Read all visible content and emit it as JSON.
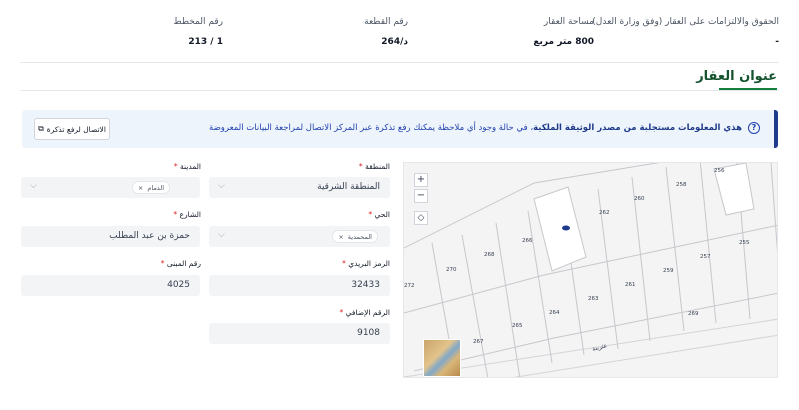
{
  "header": {
    "rights_label": "الحقوق والالتزامات على العقار (وفق وزارة العدل)",
    "rights_value": "-",
    "area_label": "مساحة العقار",
    "area_value": "800 متر مربع",
    "plot_label": "رقم القطعة",
    "plot_value": "264/د",
    "scheme_label": "رقم المخطط",
    "scheme_value": "213 / 1"
  },
  "section": {
    "title": "عنوان العقار"
  },
  "banner": {
    "bold_text": "هذي المعلومات مستجلبة من مصدر الوثيقة الملكية",
    "text": "، في حالة وجود أي ملاحظة يمكنك رفع تذكرة عبر المركز الاتصال لمراجعة البيانات المعروضة",
    "button_label": "الاتصال لرفع تذكرة"
  },
  "form": {
    "region": {
      "label": "المنطقة",
      "value": "المنطقة الشرقية"
    },
    "city": {
      "label": "المدينة",
      "chip": "الدمام"
    },
    "district": {
      "label": "الحي",
      "chip": "المحمدية"
    },
    "street": {
      "label": "الشارع",
      "value": "حمزة بن عبد المطلب"
    },
    "postal": {
      "label": "الرمز البريدي",
      "value": "32433"
    },
    "building": {
      "label": "رقم المبنى",
      "value": "4025"
    },
    "additional": {
      "label": "الرقم الإضافي",
      "value": "9108"
    }
  },
  "map": {
    "zoom_in": "+",
    "zoom_out": "−",
    "street_name": "عثرينة",
    "parcels": [
      "256",
      "258",
      "262",
      "260",
      "266",
      "255",
      "270",
      "268",
      "257",
      "259",
      "261",
      "263",
      "264",
      "265",
      "267",
      "269",
      "272",
      "253"
    ]
  }
}
